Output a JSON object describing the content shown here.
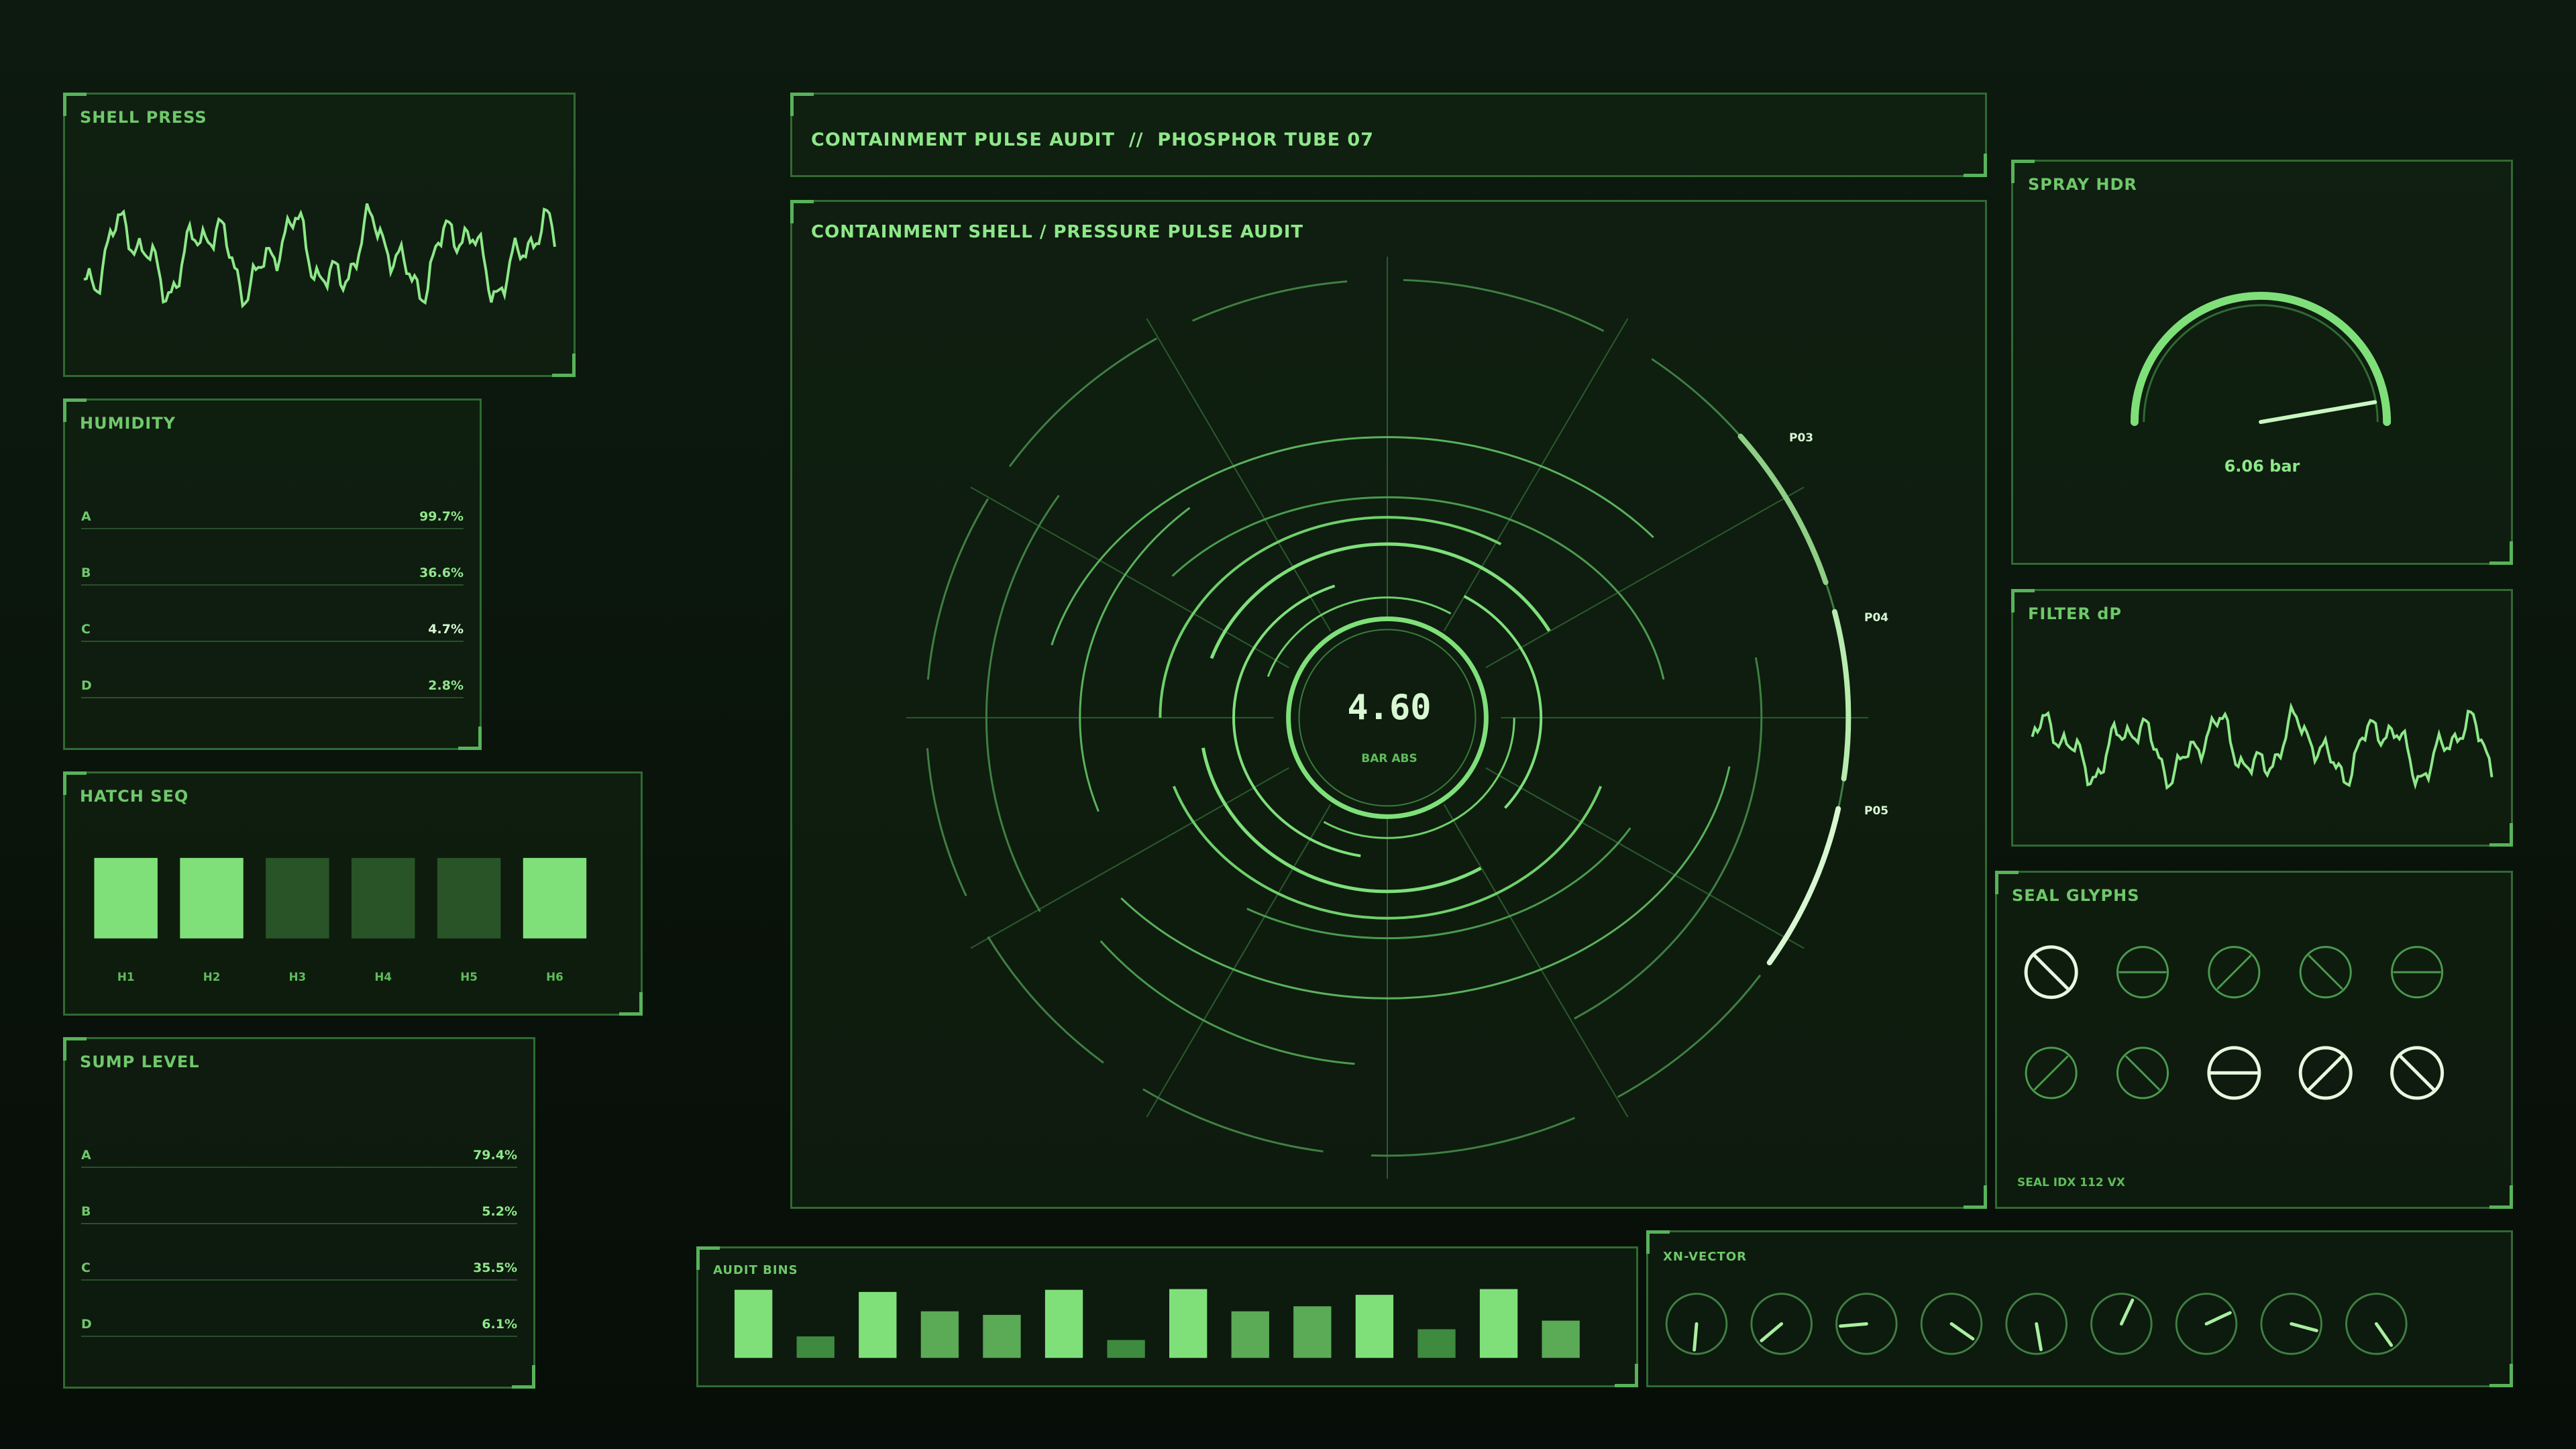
{
  "shell_press": {
    "title": "SHELL PRESS"
  },
  "humidity": {
    "title": "HUMIDITY",
    "rows": [
      {
        "label": "A",
        "value": "99.7%"
      },
      {
        "label": "B",
        "value": "36.6%"
      },
      {
        "label": "C",
        "value": "4.7%"
      },
      {
        "label": "D",
        "value": "2.8%"
      }
    ]
  },
  "hatch_seq": {
    "title": "HATCH SEQ",
    "cells": [
      {
        "label": "H1",
        "state": "on"
      },
      {
        "label": "H2",
        "state": "on"
      },
      {
        "label": "H3",
        "state": "off"
      },
      {
        "label": "H4",
        "state": "off"
      },
      {
        "label": "H5",
        "state": "off"
      },
      {
        "label": "H6",
        "state": "on"
      }
    ]
  },
  "sump_level": {
    "title": "SUMP LEVEL",
    "rows": [
      {
        "label": "A",
        "value": "79.4%"
      },
      {
        "label": "B",
        "value": "5.2%"
      },
      {
        "label": "C",
        "value": "35.5%"
      },
      {
        "label": "D",
        "value": "6.1%"
      }
    ]
  },
  "header": {
    "title": "CONTAINMENT PULSE AUDIT  //  PHOSPHOR TUBE 07"
  },
  "main": {
    "title": "CONTAINMENT SHELL / PRESSURE PULSE AUDIT",
    "center_value": "4.60",
    "center_unit": "BAR ABS",
    "markers": [
      "P03",
      "P04",
      "P05"
    ]
  },
  "spray_hdr": {
    "title": "SPRAY HDR",
    "value": "6.06 bar"
  },
  "filter_dp": {
    "title": "FILTER dP"
  },
  "seal_glyphs": {
    "title": "SEAL GLYPHS",
    "footer": "SEAL IDX 112 VX"
  },
  "audit_bins": {
    "title": "AUDIT BINS",
    "values": [
      0.95,
      0.3,
      0.92,
      0.65,
      0.6,
      0.95,
      0.25,
      0.96,
      0.65,
      0.72,
      0.88,
      0.4,
      0.96,
      0.52
    ]
  },
  "xn_vector": {
    "title": "XN-VECTOR"
  },
  "colors": {
    "accent": "#7fe07a",
    "bright": "#c8f7c2",
    "dim": "#2f6a33",
    "off": "#295427"
  }
}
